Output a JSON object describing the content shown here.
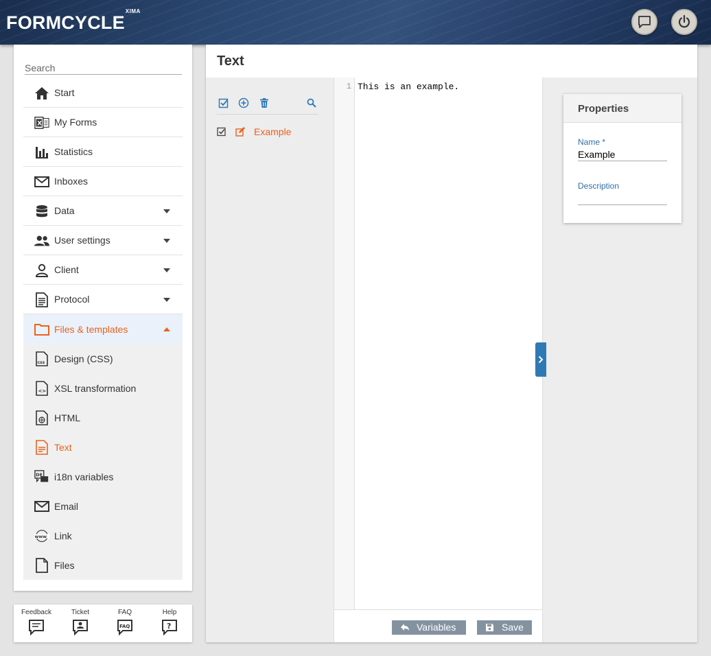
{
  "app": {
    "logo": "FORMCYCLE",
    "logo_sup": "XIMA"
  },
  "header": {
    "chat_icon": "chat-icon",
    "power_icon": "power-icon"
  },
  "sidebar": {
    "search_placeholder": "Search",
    "items": [
      {
        "label": "Start",
        "icon": "home-icon"
      },
      {
        "label": "My Forms",
        "icon": "forms-icon"
      },
      {
        "label": "Statistics",
        "icon": "statistics-icon"
      },
      {
        "label": "Inboxes",
        "icon": "mail-icon"
      },
      {
        "label": "Data",
        "icon": "database-icon"
      },
      {
        "label": "User settings",
        "icon": "users-icon"
      },
      {
        "label": "Client",
        "icon": "person-icon"
      },
      {
        "label": "Protocol",
        "icon": "document-icon"
      },
      {
        "label": "Files & templates",
        "icon": "folder-icon"
      }
    ],
    "subitems": [
      {
        "label": "Design (CSS)",
        "icon": "css-file-icon"
      },
      {
        "label": "XSL transformation",
        "icon": "xsl-file-icon"
      },
      {
        "label": "HTML",
        "icon": "html-file-icon"
      },
      {
        "label": "Text",
        "icon": "text-file-icon"
      },
      {
        "label": "i18n variables",
        "icon": "i18n-icon"
      },
      {
        "label": "Email",
        "icon": "mail-icon"
      },
      {
        "label": "Link",
        "icon": "www-icon"
      },
      {
        "label": "Files",
        "icon": "file-icon"
      }
    ]
  },
  "footer_links": [
    {
      "label": "Feedback",
      "icon": "feedback-icon"
    },
    {
      "label": "Ticket",
      "icon": "ticket-icon"
    },
    {
      "label": "FAQ",
      "icon": "faq-icon"
    },
    {
      "label": "Help",
      "icon": "help-icon"
    }
  ],
  "main": {
    "title": "Text",
    "files": [
      {
        "name": "Example"
      }
    ],
    "editor": {
      "line_number": "1",
      "content": "This is an example."
    },
    "buttons": {
      "variables": "Variables",
      "save": "Save"
    },
    "properties": {
      "title": "Properties",
      "name_label": "Name *",
      "name_value": "Example",
      "description_label": "Description",
      "description_value": ""
    }
  },
  "colors": {
    "accent": "#e8621e",
    "primary": "#2f7ab5",
    "button": "#8492a0"
  }
}
